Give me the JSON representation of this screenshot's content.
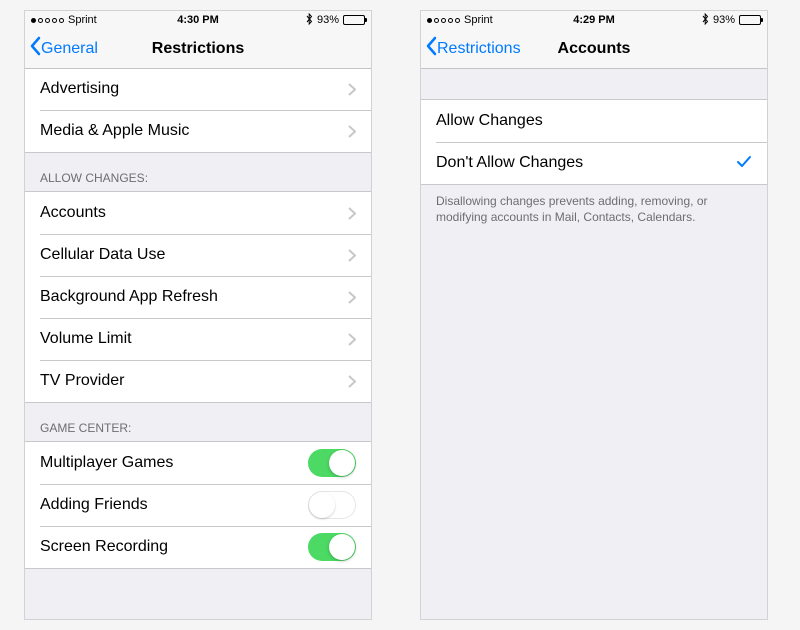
{
  "left": {
    "status": {
      "carrier": "Sprint",
      "time": "4:30 PM",
      "battery_pct": "93%",
      "battery_fill_pct": 93,
      "bt": "✽"
    },
    "nav": {
      "back": "General",
      "title": "Restrictions"
    },
    "group1": [
      {
        "label": "Advertising"
      },
      {
        "label": "Media & Apple Music"
      }
    ],
    "section_allow": "ALLOW CHANGES:",
    "group2": [
      {
        "label": "Accounts"
      },
      {
        "label": "Cellular Data Use"
      },
      {
        "label": "Background App Refresh"
      },
      {
        "label": "Volume Limit"
      },
      {
        "label": "TV Provider"
      }
    ],
    "section_game": "GAME CENTER:",
    "group3": [
      {
        "label": "Multiplayer Games",
        "on": true
      },
      {
        "label": "Adding Friends",
        "on": false
      },
      {
        "label": "Screen Recording",
        "on": true
      }
    ]
  },
  "right": {
    "status": {
      "carrier": "Sprint",
      "time": "4:29 PM",
      "battery_pct": "93%",
      "battery_fill_pct": 93,
      "bt": "✽"
    },
    "nav": {
      "back": "Restrictions",
      "title": "Accounts"
    },
    "options": [
      {
        "label": "Allow Changes",
        "selected": false
      },
      {
        "label": "Don't Allow Changes",
        "selected": true
      }
    ],
    "footer": "Disallowing changes prevents adding, removing, or modifying accounts in Mail, Contacts, Calendars."
  }
}
